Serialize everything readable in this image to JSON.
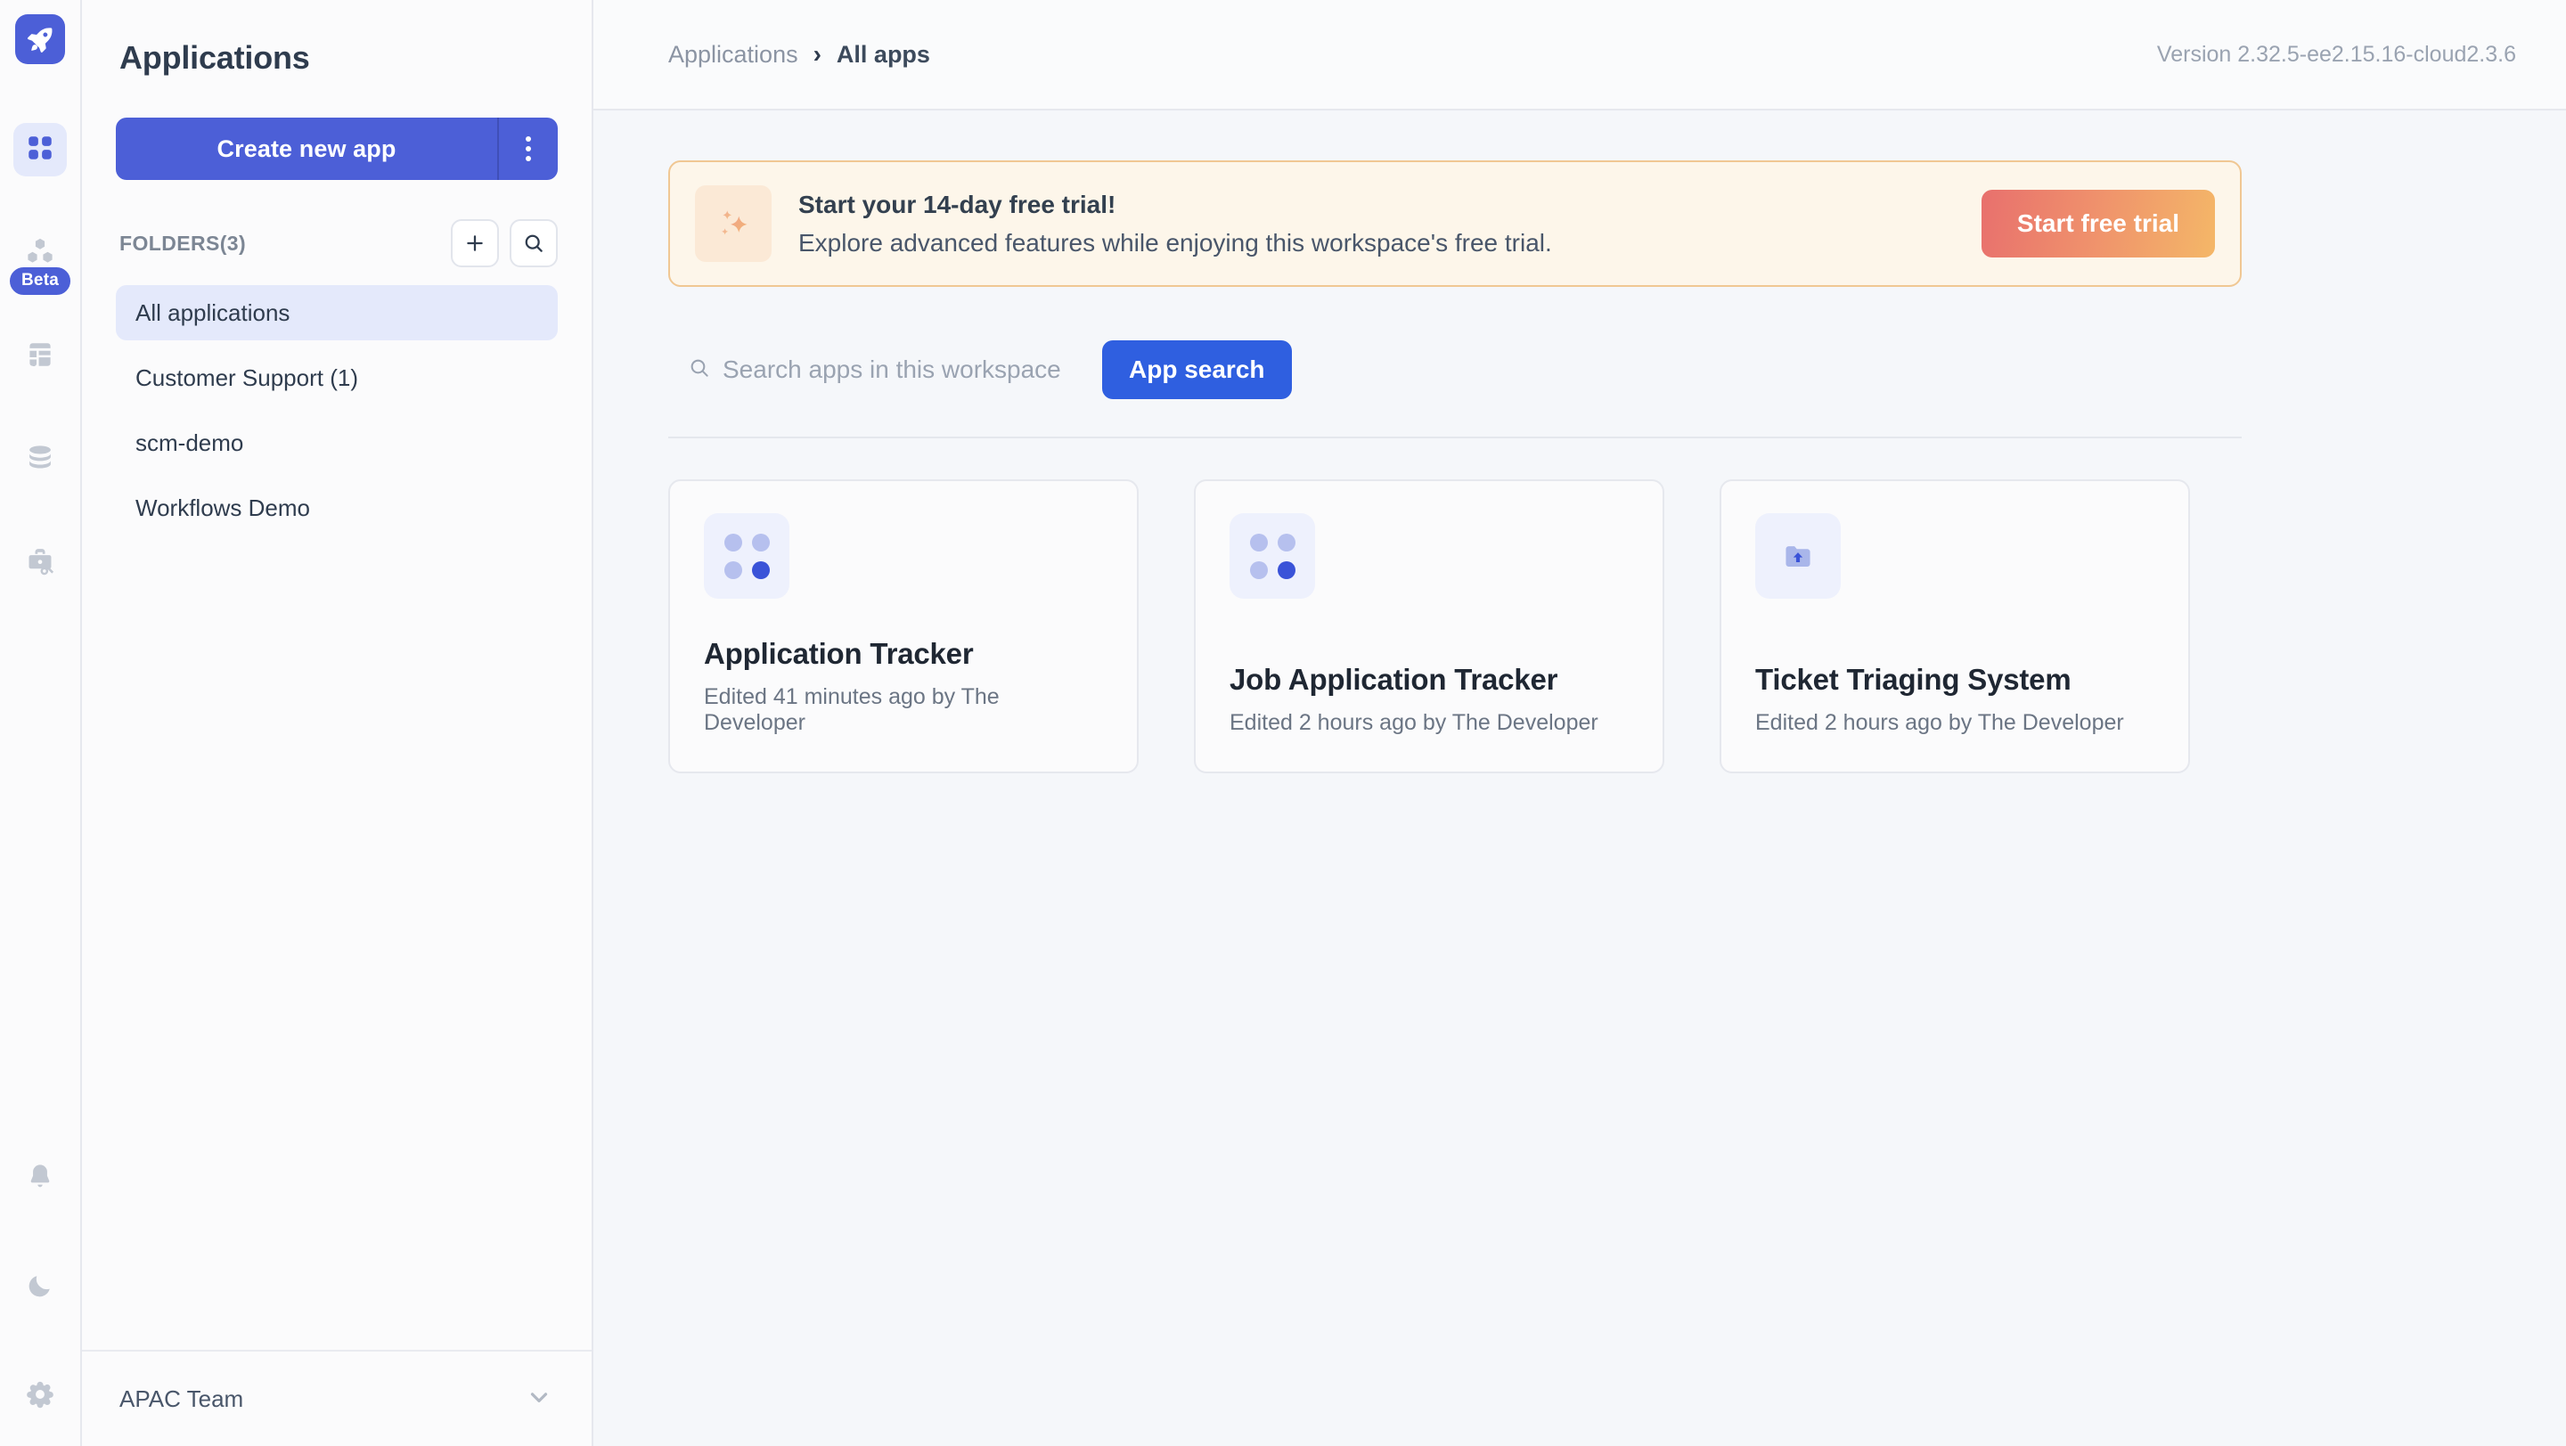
{
  "rail": {
    "logo_name": "rocket-logo",
    "items": [
      {
        "name": "apps-grid",
        "icon": "grid-icon",
        "active": true,
        "badge": null
      },
      {
        "name": "workflows",
        "icon": "hexagons-icon",
        "active": false,
        "badge": "Beta"
      },
      {
        "name": "dashboards",
        "icon": "layout-icon",
        "active": false,
        "badge": null
      },
      {
        "name": "datasources",
        "icon": "database-icon",
        "active": false,
        "badge": null
      },
      {
        "name": "toolkit",
        "icon": "briefcase-key-icon",
        "active": false,
        "badge": null
      }
    ],
    "bottom": [
      {
        "name": "notifications",
        "icon": "bell-icon"
      },
      {
        "name": "dark-mode",
        "icon": "moon-icon"
      },
      {
        "name": "settings",
        "icon": "gear-icon"
      }
    ]
  },
  "sidebar": {
    "title": "Applications",
    "create_label": "Create new app",
    "folders_label": "FOLDERS(3)",
    "add_icon": "plus-icon",
    "search_icon": "search-icon",
    "folders": [
      {
        "label": "All applications",
        "selected": true
      },
      {
        "label": "Customer Support (1)",
        "selected": false
      },
      {
        "label": "scm-demo",
        "selected": false
      },
      {
        "label": "Workflows Demo",
        "selected": false
      }
    ],
    "footer": {
      "label": "APAC Team",
      "chevron": "chevron-down-icon"
    }
  },
  "topbar": {
    "breadcrumb": [
      {
        "label": "Applications",
        "current": false
      },
      {
        "label": "All apps",
        "current": true
      }
    ],
    "separator": "›",
    "version": "Version 2.32.5-ee2.15.16-cloud2.3.6"
  },
  "banner": {
    "icon": "sparkles-icon",
    "title": "Start your 14-day free trial!",
    "subtitle": "Explore advanced features while enjoying this workspace's free trial.",
    "cta_label": "Start free trial",
    "gradient_from": "#e8706d",
    "gradient_to": "#f4b768",
    "background": "#fdf6ea",
    "border": "#f0c793"
  },
  "search": {
    "placeholder": "Search apps in this workspace",
    "value": "",
    "icon": "search-icon",
    "button_label": "App search",
    "button_color": "#2f5fe0"
  },
  "apps": [
    {
      "name": "Application Tracker",
      "meta": "Edited 41 minutes ago by The Developer",
      "icon": "dot-grid-icon"
    },
    {
      "name": "Job Application Tracker",
      "meta": "Edited 2 hours ago by The Developer",
      "icon": "dot-grid-icon"
    },
    {
      "name": "Ticket Triaging System",
      "meta": "Edited 2 hours ago by The Developer",
      "icon": "folder-upload-icon"
    }
  ],
  "theme": {
    "accent": "#4c5fd7",
    "accent_bright": "#2f5fe0",
    "selected_bg": "#e4e9fb",
    "main_bg": "#f5f7fa",
    "panel_bg": "#fbfbfc"
  }
}
